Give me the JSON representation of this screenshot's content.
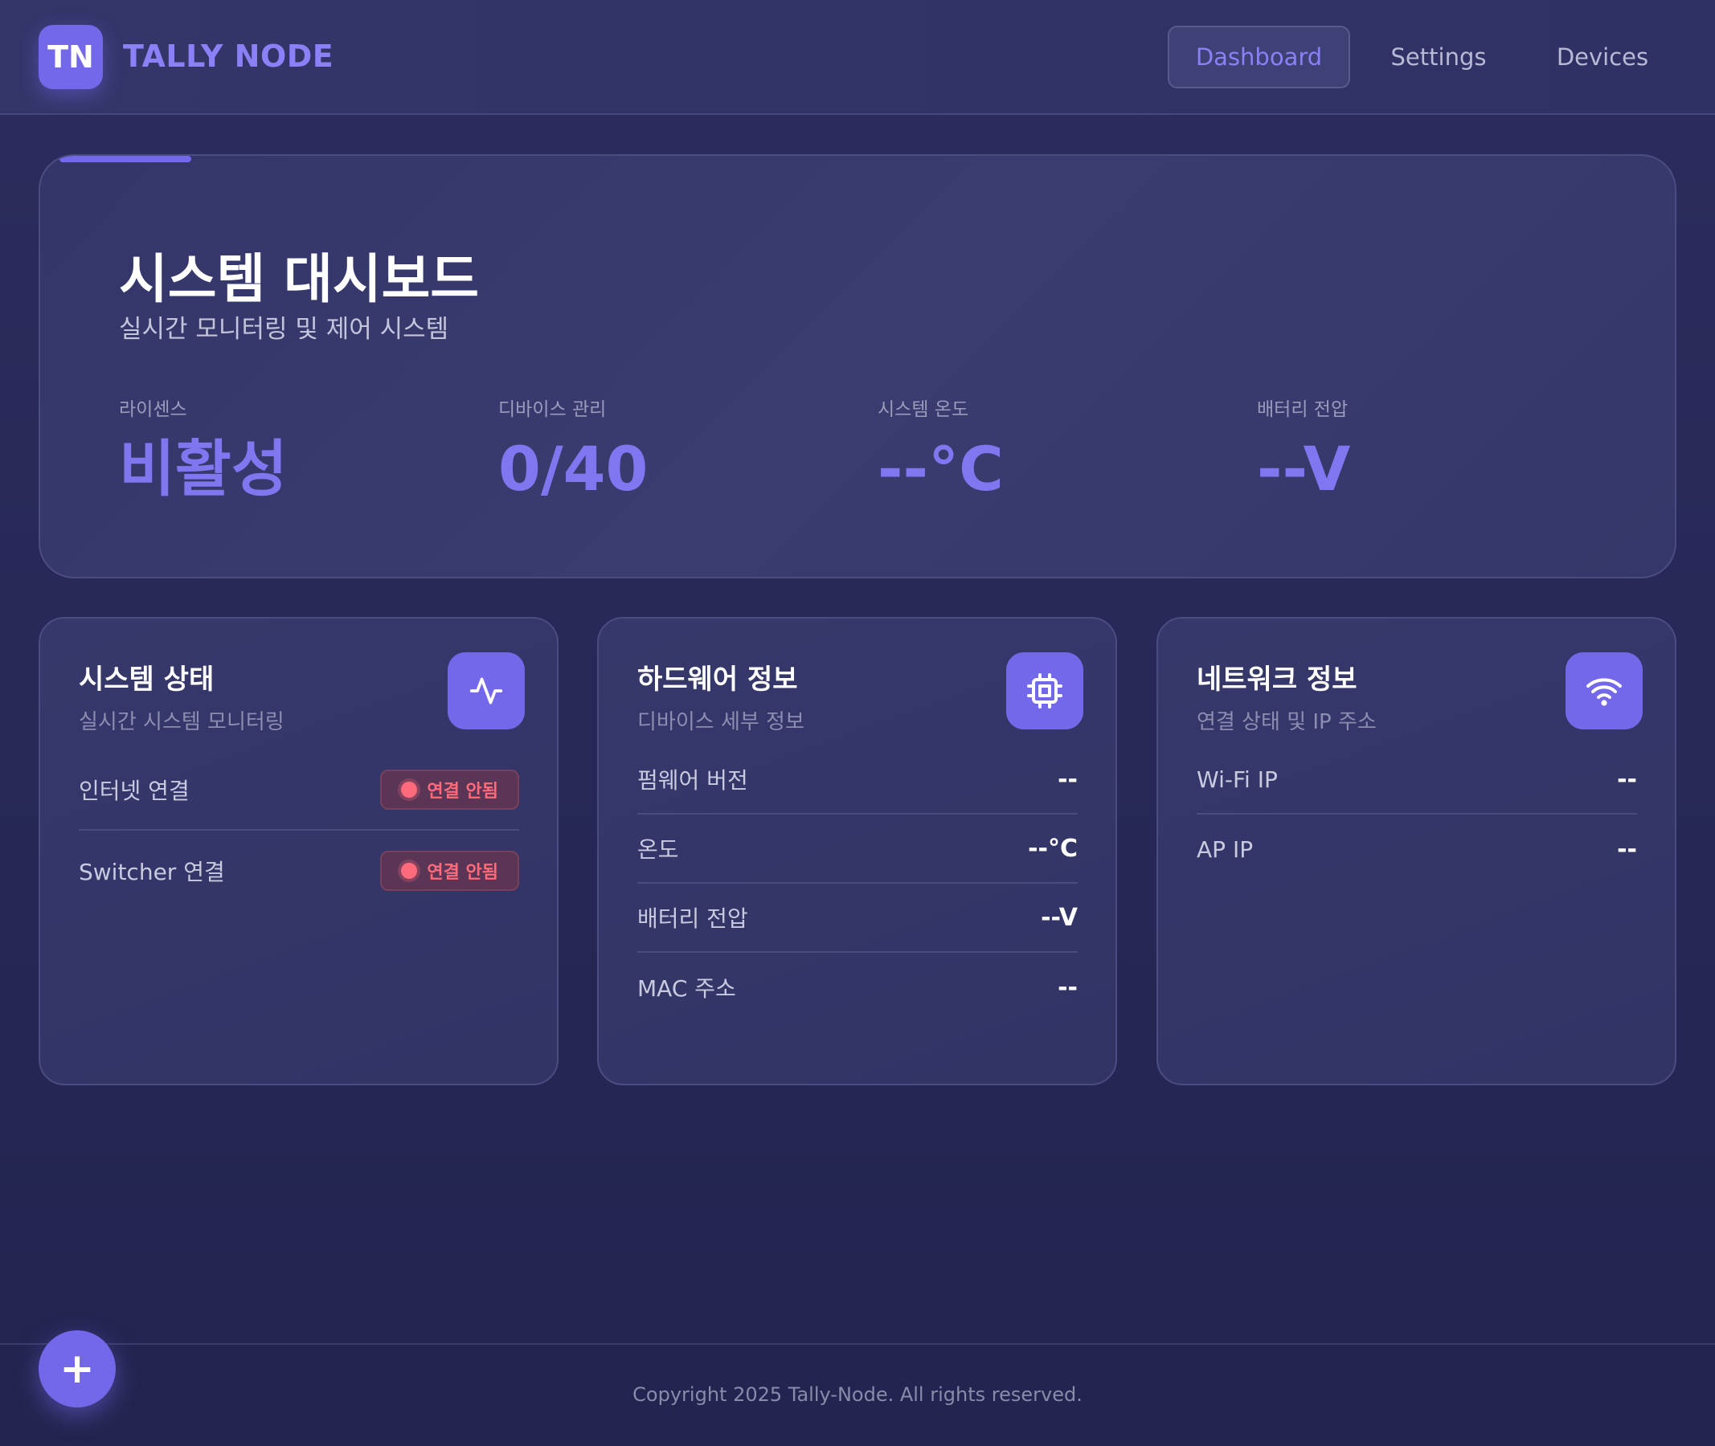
{
  "header": {
    "logo_initials": "TN",
    "app_name": "TALLY NODE",
    "nav": [
      {
        "label": "Dashboard",
        "active": true
      },
      {
        "label": "Settings",
        "active": false
      },
      {
        "label": "Devices",
        "active": false
      }
    ]
  },
  "hero": {
    "title": "시스템 대시보드",
    "subtitle": "실시간 모니터링 및 제어 시스템",
    "stats": [
      {
        "label": "라이센스",
        "value": "비활성"
      },
      {
        "label": "디바이스 관리",
        "value": "0/40"
      },
      {
        "label": "시스템 온도",
        "value": "--°C"
      },
      {
        "label": "배터리 전압",
        "value": "--V"
      }
    ]
  },
  "cards": {
    "system_status": {
      "title": "시스템 상태",
      "subtitle": "실시간 시스템 모니터링",
      "icon": "activity-icon",
      "rows": [
        {
          "label": "인터넷 연결",
          "status": "연결 안됨"
        },
        {
          "label": "Switcher 연결",
          "status": "연결 안됨"
        }
      ]
    },
    "hardware": {
      "title": "하드웨어 정보",
      "subtitle": "디바이스 세부 정보",
      "icon": "cpu-icon",
      "rows": [
        {
          "label": "펌웨어 버전",
          "value": "--"
        },
        {
          "label": "온도",
          "value": "--°C"
        },
        {
          "label": "배터리 전압",
          "value": "--V"
        },
        {
          "label": "MAC 주소",
          "value": "--"
        }
      ]
    },
    "network": {
      "title": "네트워크 정보",
      "subtitle": "연결 상태 및 IP 주소",
      "icon": "wifi-icon",
      "rows": [
        {
          "label": "Wi-Fi IP",
          "value": "--"
        },
        {
          "label": "AP IP",
          "value": "--"
        }
      ]
    }
  },
  "footer": {
    "fab_label": "+",
    "copyright": "Copyright 2025 Tally-Node. All rights reserved."
  },
  "colors": {
    "accent": "#7367ea",
    "stat_value": "#8076f0",
    "error": "#ff6b7a"
  }
}
